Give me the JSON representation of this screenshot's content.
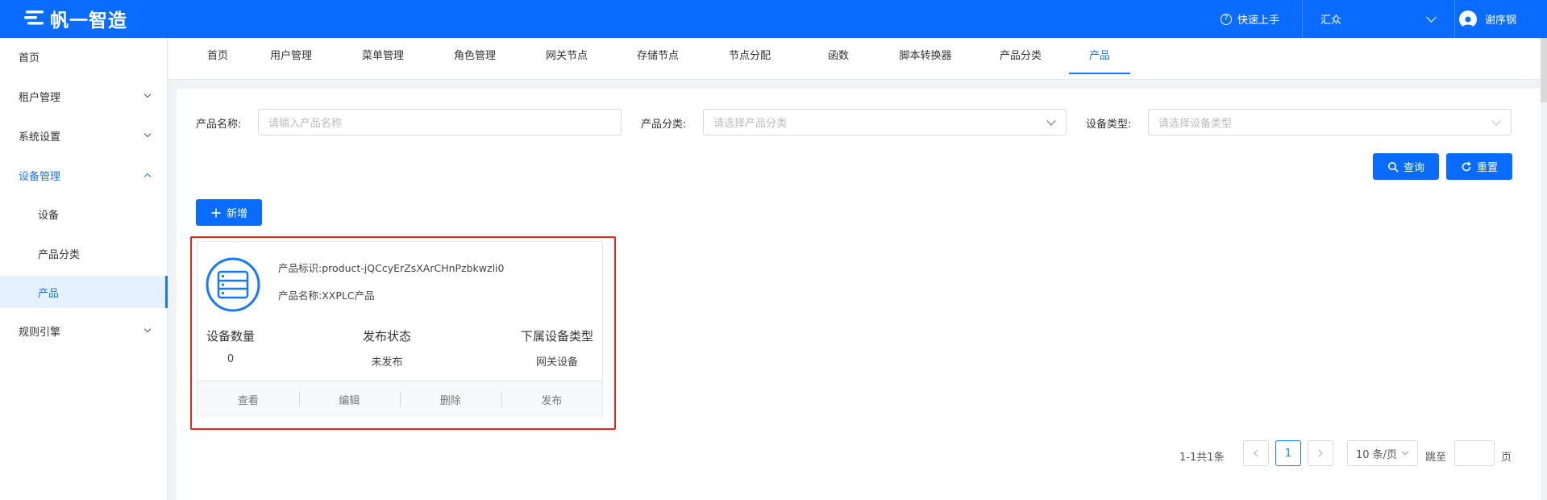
{
  "header": {
    "brand": "帆一智造",
    "quick_start": "快速上手",
    "tenant": "汇众",
    "username": "谢序钢"
  },
  "sidebar": {
    "items": [
      {
        "label": "首页"
      },
      {
        "label": "租户管理"
      },
      {
        "label": "系统设置"
      },
      {
        "label": "设备管理"
      },
      {
        "label": "设备"
      },
      {
        "label": "产品分类"
      },
      {
        "label": "产品"
      },
      {
        "label": "规则引擎"
      }
    ]
  },
  "tabs": [
    {
      "label": "首页"
    },
    {
      "label": "用户管理"
    },
    {
      "label": "菜单管理"
    },
    {
      "label": "角色管理"
    },
    {
      "label": "网关节点"
    },
    {
      "label": "存储节点"
    },
    {
      "label": "节点分配"
    },
    {
      "label": "函数"
    },
    {
      "label": "脚本转换器"
    },
    {
      "label": "产品分类"
    },
    {
      "label": "产品"
    }
  ],
  "filters": {
    "name_label": "产品名称:",
    "name_placeholder": "请输入产品名称",
    "category_label": "产品分类:",
    "category_placeholder": "请选择产品分类",
    "device_type_label": "设备类型:",
    "device_type_placeholder": "请选择设备类型"
  },
  "buttons": {
    "query": "查询",
    "reset": "重置",
    "add": "新增"
  },
  "card": {
    "id_text": "产品标识:product-jQCcyErZsXArCHnPzbkwzli0",
    "name_text": "产品名称:XXPLC产品",
    "stats": [
      {
        "label": "设备数量",
        "value": "0"
      },
      {
        "label": "发布状态",
        "value": "未发布"
      },
      {
        "label": "下属设备类型",
        "value": "网关设备"
      }
    ],
    "actions": [
      "查看",
      "编辑",
      "删除",
      "发布"
    ]
  },
  "pagination": {
    "total": "1-1共1条",
    "current_page": "1",
    "page_size": "10 条/页",
    "jump_label": "跳至",
    "jump_unit": "页"
  },
  "colors": {
    "primary": "#0a6cff",
    "highlight": "#e8261f"
  }
}
